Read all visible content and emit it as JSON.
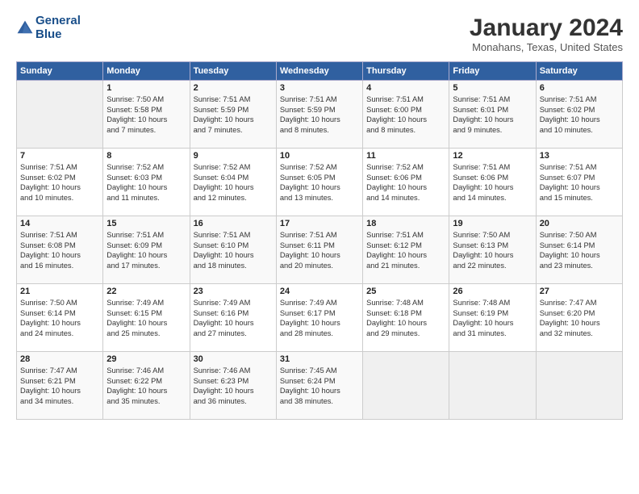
{
  "logo": {
    "line1": "General",
    "line2": "Blue"
  },
  "title": "January 2024",
  "subtitle": "Monahans, Texas, United States",
  "header_days": [
    "Sunday",
    "Monday",
    "Tuesday",
    "Wednesday",
    "Thursday",
    "Friday",
    "Saturday"
  ],
  "weeks": [
    [
      {
        "day": "",
        "text": ""
      },
      {
        "day": "1",
        "text": "Sunrise: 7:50 AM\nSunset: 5:58 PM\nDaylight: 10 hours\nand 7 minutes."
      },
      {
        "day": "2",
        "text": "Sunrise: 7:51 AM\nSunset: 5:59 PM\nDaylight: 10 hours\nand 7 minutes."
      },
      {
        "day": "3",
        "text": "Sunrise: 7:51 AM\nSunset: 5:59 PM\nDaylight: 10 hours\nand 8 minutes."
      },
      {
        "day": "4",
        "text": "Sunrise: 7:51 AM\nSunset: 6:00 PM\nDaylight: 10 hours\nand 8 minutes."
      },
      {
        "day": "5",
        "text": "Sunrise: 7:51 AM\nSunset: 6:01 PM\nDaylight: 10 hours\nand 9 minutes."
      },
      {
        "day": "6",
        "text": "Sunrise: 7:51 AM\nSunset: 6:02 PM\nDaylight: 10 hours\nand 10 minutes."
      }
    ],
    [
      {
        "day": "7",
        "text": "Sunrise: 7:51 AM\nSunset: 6:02 PM\nDaylight: 10 hours\nand 10 minutes."
      },
      {
        "day": "8",
        "text": "Sunrise: 7:52 AM\nSunset: 6:03 PM\nDaylight: 10 hours\nand 11 minutes."
      },
      {
        "day": "9",
        "text": "Sunrise: 7:52 AM\nSunset: 6:04 PM\nDaylight: 10 hours\nand 12 minutes."
      },
      {
        "day": "10",
        "text": "Sunrise: 7:52 AM\nSunset: 6:05 PM\nDaylight: 10 hours\nand 13 minutes."
      },
      {
        "day": "11",
        "text": "Sunrise: 7:52 AM\nSunset: 6:06 PM\nDaylight: 10 hours\nand 14 minutes."
      },
      {
        "day": "12",
        "text": "Sunrise: 7:51 AM\nSunset: 6:06 PM\nDaylight: 10 hours\nand 14 minutes."
      },
      {
        "day": "13",
        "text": "Sunrise: 7:51 AM\nSunset: 6:07 PM\nDaylight: 10 hours\nand 15 minutes."
      }
    ],
    [
      {
        "day": "14",
        "text": "Sunrise: 7:51 AM\nSunset: 6:08 PM\nDaylight: 10 hours\nand 16 minutes."
      },
      {
        "day": "15",
        "text": "Sunrise: 7:51 AM\nSunset: 6:09 PM\nDaylight: 10 hours\nand 17 minutes."
      },
      {
        "day": "16",
        "text": "Sunrise: 7:51 AM\nSunset: 6:10 PM\nDaylight: 10 hours\nand 18 minutes."
      },
      {
        "day": "17",
        "text": "Sunrise: 7:51 AM\nSunset: 6:11 PM\nDaylight: 10 hours\nand 20 minutes."
      },
      {
        "day": "18",
        "text": "Sunrise: 7:51 AM\nSunset: 6:12 PM\nDaylight: 10 hours\nand 21 minutes."
      },
      {
        "day": "19",
        "text": "Sunrise: 7:50 AM\nSunset: 6:13 PM\nDaylight: 10 hours\nand 22 minutes."
      },
      {
        "day": "20",
        "text": "Sunrise: 7:50 AM\nSunset: 6:14 PM\nDaylight: 10 hours\nand 23 minutes."
      }
    ],
    [
      {
        "day": "21",
        "text": "Sunrise: 7:50 AM\nSunset: 6:14 PM\nDaylight: 10 hours\nand 24 minutes."
      },
      {
        "day": "22",
        "text": "Sunrise: 7:49 AM\nSunset: 6:15 PM\nDaylight: 10 hours\nand 25 minutes."
      },
      {
        "day": "23",
        "text": "Sunrise: 7:49 AM\nSunset: 6:16 PM\nDaylight: 10 hours\nand 27 minutes."
      },
      {
        "day": "24",
        "text": "Sunrise: 7:49 AM\nSunset: 6:17 PM\nDaylight: 10 hours\nand 28 minutes."
      },
      {
        "day": "25",
        "text": "Sunrise: 7:48 AM\nSunset: 6:18 PM\nDaylight: 10 hours\nand 29 minutes."
      },
      {
        "day": "26",
        "text": "Sunrise: 7:48 AM\nSunset: 6:19 PM\nDaylight: 10 hours\nand 31 minutes."
      },
      {
        "day": "27",
        "text": "Sunrise: 7:47 AM\nSunset: 6:20 PM\nDaylight: 10 hours\nand 32 minutes."
      }
    ],
    [
      {
        "day": "28",
        "text": "Sunrise: 7:47 AM\nSunset: 6:21 PM\nDaylight: 10 hours\nand 34 minutes."
      },
      {
        "day": "29",
        "text": "Sunrise: 7:46 AM\nSunset: 6:22 PM\nDaylight: 10 hours\nand 35 minutes."
      },
      {
        "day": "30",
        "text": "Sunrise: 7:46 AM\nSunset: 6:23 PM\nDaylight: 10 hours\nand 36 minutes."
      },
      {
        "day": "31",
        "text": "Sunrise: 7:45 AM\nSunset: 6:24 PM\nDaylight: 10 hours\nand 38 minutes."
      },
      {
        "day": "",
        "text": ""
      },
      {
        "day": "",
        "text": ""
      },
      {
        "day": "",
        "text": ""
      }
    ]
  ]
}
